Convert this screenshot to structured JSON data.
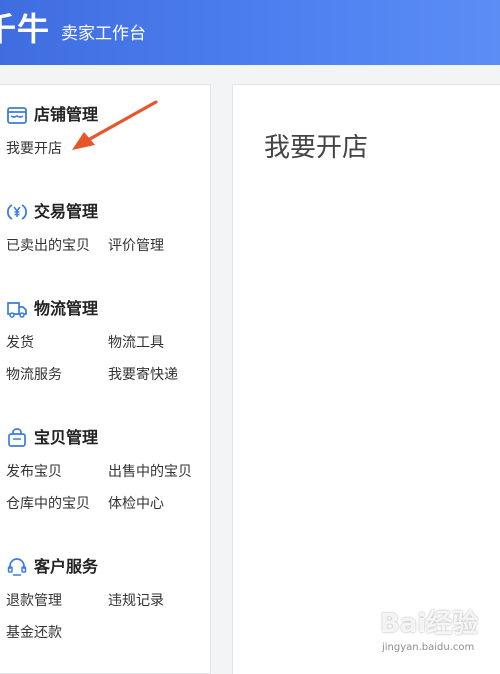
{
  "header": {
    "brand": "千牛",
    "subtitle": "卖家工作台"
  },
  "sidebar": {
    "sections": [
      {
        "title": "店铺管理",
        "icon": "shop-icon",
        "links": [
          "我要开店"
        ]
      },
      {
        "title": "交易管理",
        "icon": "yuan-icon",
        "links": [
          "已卖出的宝贝",
          "评价管理"
        ]
      },
      {
        "title": "物流管理",
        "icon": "truck-icon",
        "links": [
          "发货",
          "物流工具",
          "物流服务",
          "我要寄快递"
        ]
      },
      {
        "title": "宝贝管理",
        "icon": "bag-icon",
        "links": [
          "发布宝贝",
          "出售中的宝贝",
          "仓库中的宝贝",
          "体检中心"
        ]
      },
      {
        "title": "客户服务",
        "icon": "headset-icon",
        "links": [
          "退款管理",
          "违规记录",
          "基金还款"
        ]
      }
    ]
  },
  "main": {
    "title": "我要开店"
  },
  "annotation": {
    "arrow_color": "#e8552a"
  },
  "watermark": {
    "text": "Bai经验",
    "sub": "jingyan.baidu.com"
  },
  "colors": {
    "header_blue": "#4a78ec",
    "icon_blue": "#3b7ddb"
  }
}
